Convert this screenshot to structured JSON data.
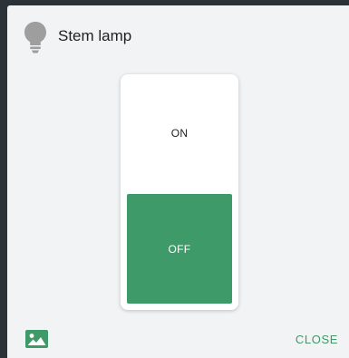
{
  "dialog": {
    "title": "Stem lamp",
    "icon": "lightbulb-icon"
  },
  "switch": {
    "on_label": "ON",
    "off_label": "OFF",
    "state": "off",
    "active_color": "#3e9a68"
  },
  "footer": {
    "image_icon": "image-icon",
    "close_label": "CLOSE"
  },
  "colors": {
    "accent": "#3e9a68",
    "icon_gray": "#9e9e9e"
  }
}
